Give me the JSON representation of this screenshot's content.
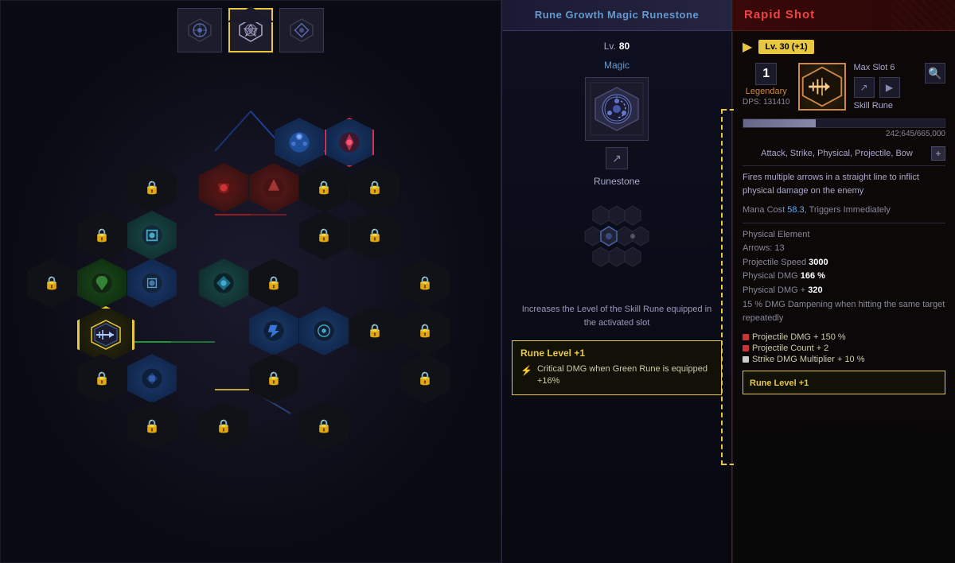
{
  "left_panel": {
    "top_runes": [
      {
        "id": "rune1",
        "selected": false
      },
      {
        "id": "rune2",
        "selected": true
      },
      {
        "id": "rune3",
        "selected": false
      }
    ]
  },
  "middle_panel": {
    "header": "Rune Growth Magic Runestone",
    "level_label": "Lv.",
    "level_value": "80",
    "item_type": "Magic",
    "item_name": "Runestone",
    "description": "Increases the Level of the Skill Rune equipped in the activated slot",
    "rune_level_box": {
      "title": "Rune Level +1",
      "stat_icon": "⚡",
      "stat_text": "Critical DMG when Green Rune is equipped +16%"
    }
  },
  "right_panel": {
    "header_title": "Rapid Shot",
    "level_label": "Lv. 30 (+1)",
    "qty": "1",
    "qty_label": "Legendary",
    "dps_label": "DPS: 131410",
    "max_slot": "Max Slot 6",
    "skill_rune_label": "Skill Rune",
    "exp_current": "242,645",
    "exp_total": "665,000",
    "exp_display": "242;645/665,000",
    "tags": "Attack, Strike, Physical, Projectile, Bow",
    "description": "Fires multiple arrows in a straight line to inflict physical damage on the enemy",
    "mana_cost_label": "Mana Cost",
    "mana_cost_value": "58.3",
    "mana_suffix": ", Triggers Immediately",
    "element": "Physical Element",
    "arrows_label": "Arrows:",
    "arrows_value": "13",
    "proj_speed_label": "Projectile Speed",
    "proj_speed_value": "3000",
    "phys_dmg_label": "Physical DMG",
    "phys_dmg_value": "166 %",
    "phys_dmg_plus_label": "Physical DMG +",
    "phys_dmg_plus_value": "320",
    "dmg_dampening": "15 % DMG Dampening when hitting the same target repeatedly",
    "rune_bonus1": "Projectile DMG + 150 %",
    "rune_bonus2": "Projectile Count + 2",
    "rune_bonus3": "Strike DMG Multiplier + 10 %",
    "rune_level_title": "Rune Level +1"
  },
  "icons": {
    "lock": "🔒",
    "share": "↗",
    "play": "▶",
    "search": "🔍",
    "plus": "+",
    "arrow_right": "▶",
    "lightning": "⚡"
  }
}
